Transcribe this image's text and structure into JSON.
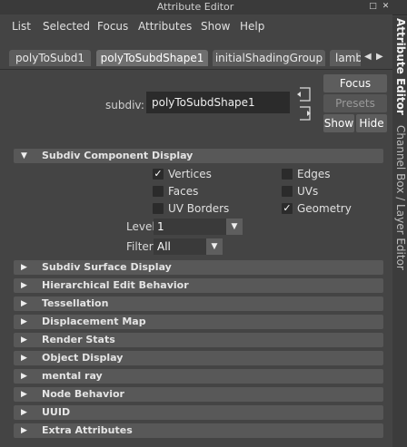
{
  "window": {
    "title": "Attribute Editor"
  },
  "menubar": [
    "List",
    "Selected",
    "Focus",
    "Attributes",
    "Show",
    "Help"
  ],
  "tabs": [
    "polyToSubd1",
    "polyToSubdShape1",
    "initialShadingGroup",
    "lamb"
  ],
  "node": {
    "label": "subdiv:",
    "value": "polyToSubdShape1"
  },
  "buttons": {
    "focus": "Focus",
    "presets": "Presets",
    "show": "Show",
    "hide": "Hide"
  },
  "side_tabs": {
    "attribute_editor": "Attribute Editor",
    "channel_box": "Channel Box / Layer Editor"
  },
  "component_display": {
    "title": "Subdiv Component Display",
    "checkboxes": [
      {
        "label": "Vertices",
        "checked": true
      },
      {
        "label": "Edges",
        "checked": false
      },
      {
        "label": "Faces",
        "checked": false
      },
      {
        "label": "UVs",
        "checked": false
      },
      {
        "label": "UV Borders",
        "checked": false
      },
      {
        "label": "Geometry",
        "checked": true
      }
    ],
    "level": {
      "label": "Level",
      "value": "1"
    },
    "filter": {
      "label": "Filter",
      "value": "All"
    }
  },
  "collapsed_sections": [
    "Subdiv Surface Display",
    "Hierarchical Edit Behavior",
    "Tessellation",
    "Displacement Map",
    "Render Stats",
    "Object Display",
    "mental ray",
    "Node Behavior",
    "UUID",
    "Extra Attributes"
  ]
}
